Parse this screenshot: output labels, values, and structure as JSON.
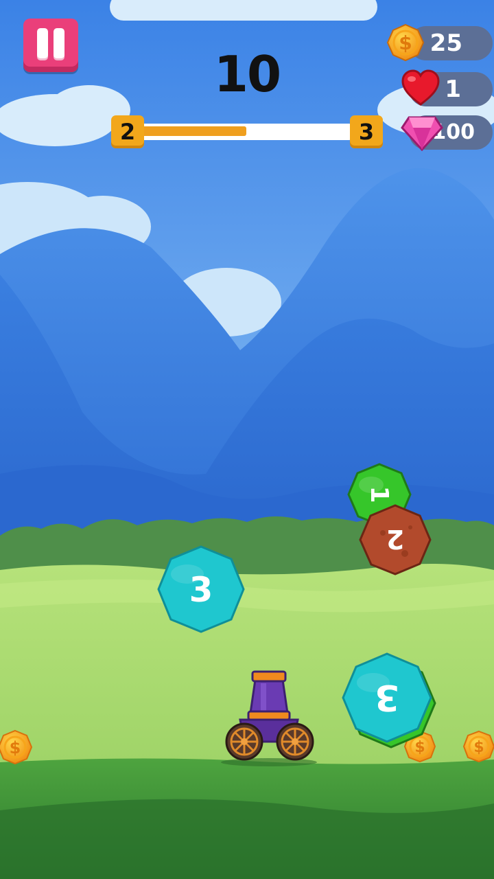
{
  "hud": {
    "score": "10",
    "level_current": "2",
    "level_next": "3",
    "level_progress": 0.5,
    "coins": "25",
    "lives": "1",
    "gems": "100"
  },
  "balls": [
    {
      "label": "1",
      "color": "#36c62a",
      "rotation": 90
    },
    {
      "label": "2",
      "color": "#b24a2c",
      "rotation": 180
    },
    {
      "label": "3",
      "color": "#1fc7cf",
      "rotation": 0
    },
    {
      "label": "3",
      "color": "#1fc7cf",
      "rotation": 180
    }
  ],
  "colors": {
    "sky_top": "#3b82e6",
    "sky_bottom": "#9cccf5",
    "grass": "#9cd66a",
    "ground": "#3a8f37",
    "accent_orange": "#f2a71b",
    "pause_pink": "#ea3f7a",
    "cannon_purple": "#6a3bb3"
  }
}
